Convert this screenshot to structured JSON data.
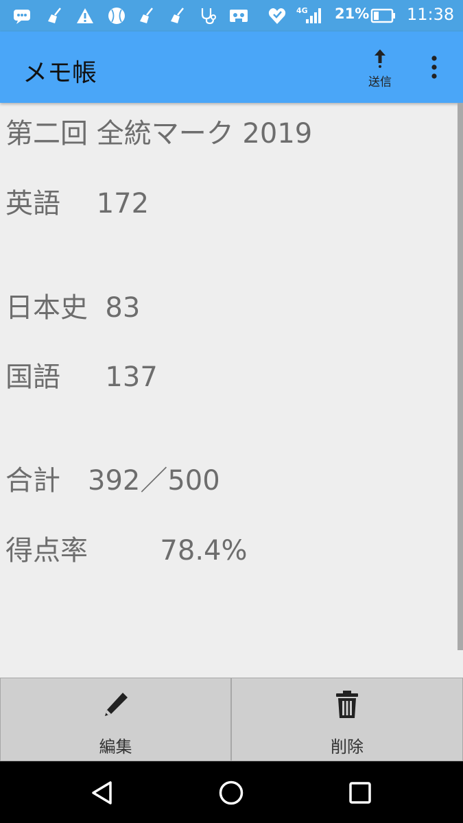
{
  "status_bar": {
    "network": "4G",
    "battery_percent": "21%",
    "time": "11:38",
    "icons": [
      "message-icon",
      "broom-icon",
      "warning-icon",
      "baseball-icon",
      "broom-icon",
      "broom-icon",
      "stethoscope-icon",
      "cassette-icon",
      "heart-shield-icon",
      "signal-icon",
      "battery-icon"
    ]
  },
  "app_bar": {
    "title": "メモ帳",
    "send_label": "送信",
    "send_icon": "upload-arrow-icon",
    "menu_icon": "more-vert-icon"
  },
  "memo": {
    "lines": [
      "第二回 全統マーク 2019",
      "英語　 172",
      "日本史  83",
      "国語　  137",
      "合計　392／500",
      "得点率　　  78.4%"
    ]
  },
  "actions": {
    "edit_label": "編集",
    "delete_label": "削除"
  },
  "nav": {
    "back": "back-icon",
    "home": "home-icon",
    "recents": "recents-icon"
  },
  "colors": {
    "status_bar": "#4ba3e3",
    "app_bar": "#4aa6f8",
    "background": "#eeeeee",
    "text": "#6d6d6d",
    "action_bar": "#cfcfcf",
    "nav_bar": "#000000"
  }
}
